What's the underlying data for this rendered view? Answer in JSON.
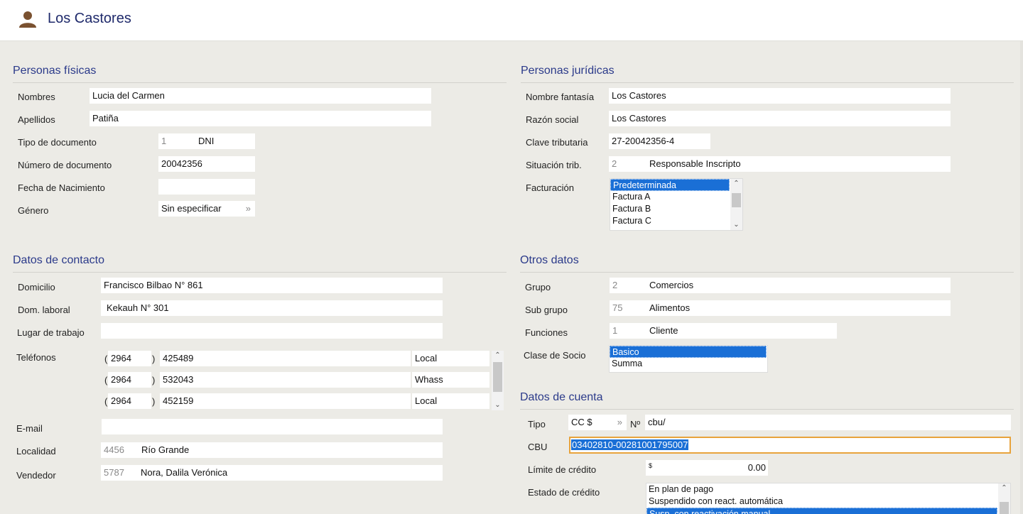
{
  "header": {
    "title": "Los Castores",
    "icon": "user-icon"
  },
  "personas_fisicas": {
    "title": "Personas físicas",
    "nombres_label": "Nombres",
    "nombres_value": "Lucia del Carmen",
    "apellidos_label": "Apellidos",
    "apellidos_value": "Patiña",
    "tipo_doc_label": "Tipo de documento",
    "tipo_doc_code": "1",
    "tipo_doc_value": "DNI",
    "num_doc_label": "Número de documento",
    "num_doc_value": "20042356",
    "fecha_nac_label": "Fecha de Nacimiento",
    "fecha_nac_value": "",
    "genero_label": "Género",
    "genero_value": "Sin especificar"
  },
  "personas_juridicas": {
    "title": "Personas jurídicas",
    "nombre_fantasia_label": "Nombre fantasía",
    "nombre_fantasia_value": "Los Castores",
    "razon_social_label": "Razón social",
    "razon_social_value": "Los Castores",
    "clave_tributaria_label": "Clave tributaria",
    "clave_tributaria_value": "27-20042356-4",
    "situacion_trib_label": "Situación trib.",
    "situacion_trib_code": "2",
    "situacion_trib_value": "Responsable Inscripto",
    "facturacion_label": "Facturación",
    "facturacion_options": [
      "Predeterminada",
      "Factura A",
      "Factura B",
      "Factura C"
    ],
    "facturacion_selected": "Predeterminada"
  },
  "datos_contacto": {
    "title": "Datos de contacto",
    "domicilio_label": "Domicilio",
    "domicilio_value": "Francisco Bilbao N° 861",
    "dom_laboral_label": "Dom. laboral",
    "dom_laboral_value": "Kekauh N° 301",
    "lugar_trabajo_label": "Lugar de trabajo",
    "lugar_trabajo_value": "",
    "telefonos_label": "Teléfonos",
    "telefonos": [
      {
        "area": "2964",
        "numero": "425489",
        "tipo": "Local"
      },
      {
        "area": "2964",
        "numero": "532043",
        "tipo": "Whass"
      },
      {
        "area": "2964",
        "numero": "452159",
        "tipo": "Local"
      }
    ],
    "paren_open": "(",
    "paren_close": ")",
    "email_label": "E-mail",
    "email_value": "",
    "localidad_label": "Localidad",
    "localidad_code": "4456",
    "localidad_value": "Río Grande",
    "vendedor_label": "Vendedor",
    "vendedor_code": "5787",
    "vendedor_value": "Nora, Dalila Verónica"
  },
  "otros_datos": {
    "title": "Otros datos",
    "grupo_label": "Grupo",
    "grupo_code": "2",
    "grupo_value": "Comercios",
    "subgrupo_label": "Sub grupo",
    "subgrupo_code": "75",
    "subgrupo_value": "Alimentos",
    "funciones_label": "Funciones",
    "funciones_code": "1",
    "funciones_value": "Cliente",
    "clase_socio_label": "Clase de Socio",
    "clase_socio_options": [
      "Basico",
      "Summa"
    ],
    "clase_socio_selected": "Basico"
  },
  "datos_cuenta": {
    "title": "Datos de cuenta",
    "tipo_label": "Tipo",
    "tipo_value": "CC $",
    "numero_label": "Nº",
    "numero_value": "cbu/",
    "cbu_label": "CBU",
    "cbu_value": "03402810-00281001795007",
    "limite_label": "Límite de crédito",
    "limite_currency": "$",
    "limite_value": "0.00",
    "estado_label": "Estado de crédito",
    "estado_options": [
      "En plan de pago",
      "Suspendido con react. automática",
      "Susp. con reactivación manual"
    ],
    "estado_selected": "Susp. con reactivación manual"
  },
  "colors": {
    "accent": "#1f2a6b",
    "section": "#2b3a8a",
    "selection": "#1a6fd6",
    "focus_border": "#e8a33c",
    "background": "#ecebe6"
  }
}
